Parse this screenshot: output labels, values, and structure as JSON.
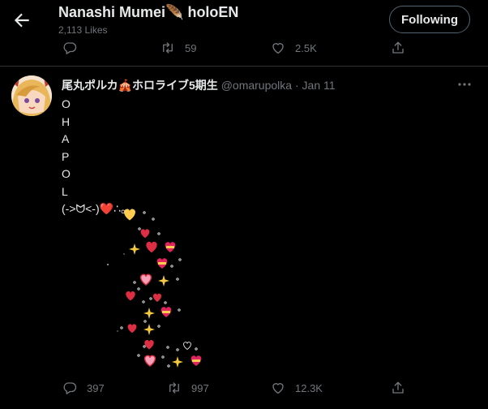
{
  "header": {
    "title": "Nanashi Mumei🪶 holoEN",
    "subtitle": "2,113 Likes",
    "follow_label": "Following"
  },
  "pinned_actions": {
    "retweets": "59",
    "likes": "2.5K"
  },
  "tweet": {
    "author": "尾丸ポルカ🎪ホロライブ5期生",
    "handle": "@omarupolka",
    "separator": "·",
    "date": "Jan 11",
    "lines": [
      "O",
      "H",
      "A",
      "P",
      "O",
      "L",
      "(->ᗢ<-)❤️∴。"
    ],
    "actions": {
      "replies": "397",
      "retweets": "997",
      "likes": "12.3K"
    }
  },
  "colors": {
    "background": "#000000",
    "text_primary": "#e7e9ea",
    "text_secondary": "#71767b",
    "divider": "#2f3336",
    "heart_red": "#dd2e44",
    "heart_yellow": "#ffcc4d",
    "sparkle": "#f4c83f"
  },
  "icons": [
    "back-arrow-icon",
    "reply-icon",
    "retweet-icon",
    "like-icon",
    "share-icon",
    "more-icon"
  ]
}
